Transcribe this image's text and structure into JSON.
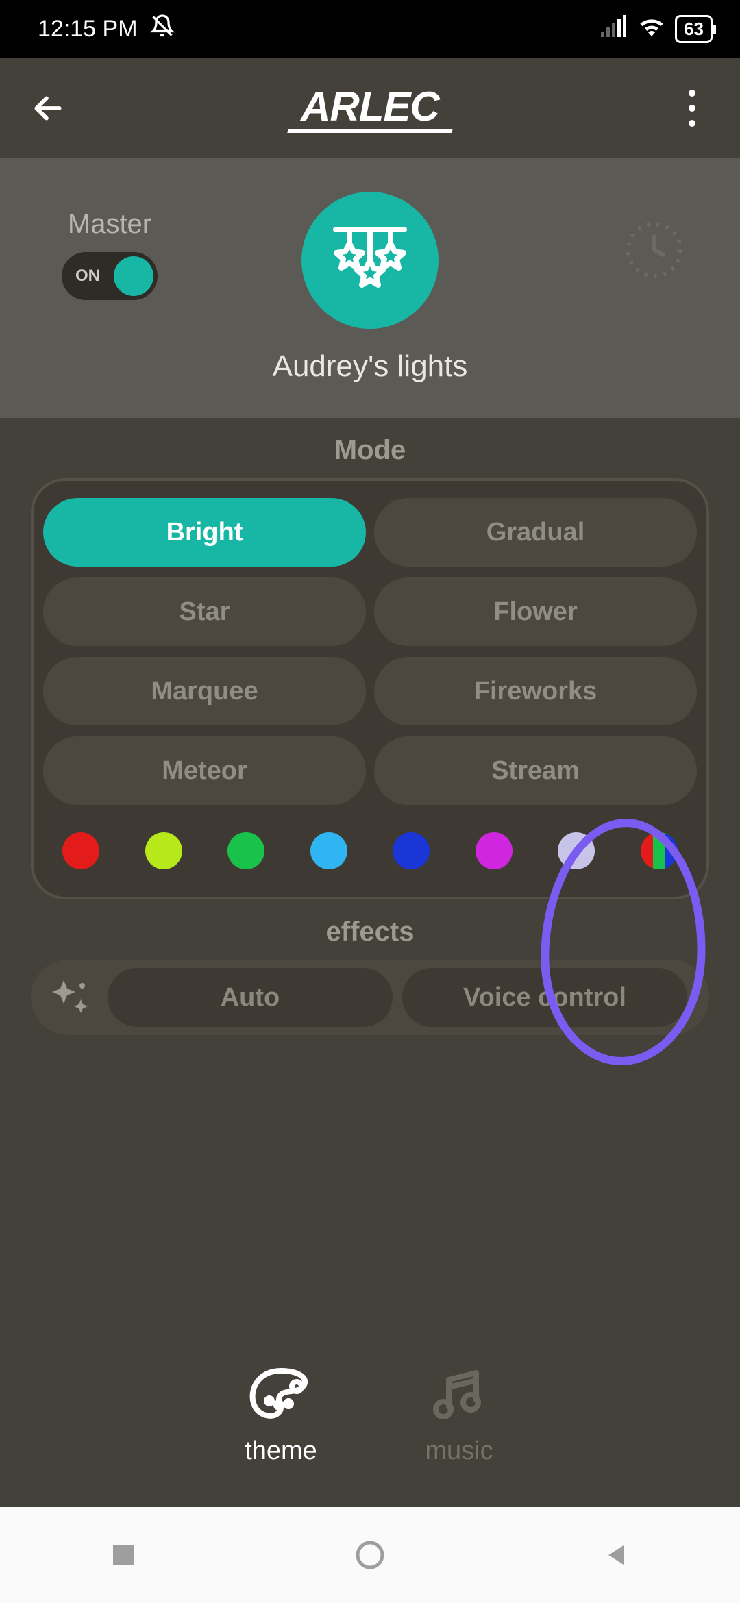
{
  "status": {
    "time": "12:15 PM",
    "battery": "63"
  },
  "header": {
    "brand": "ARLEC"
  },
  "device": {
    "master_label": "Master",
    "toggle_state": "ON",
    "name": "Audrey's lights"
  },
  "mode": {
    "title": "Mode",
    "buttons": [
      "Bright",
      "Gradual",
      "Star",
      "Flower",
      "Marquee",
      "Fireworks",
      "Meteor",
      "Stream"
    ],
    "active_index": 0,
    "colors": [
      "#e31b1b",
      "#b6e81a",
      "#19c24a",
      "#2fb6f2",
      "#1a36d6",
      "#d026e0",
      "#c7c4e8",
      "rgb"
    ]
  },
  "effects": {
    "title": "effects",
    "buttons": [
      "Auto",
      "Voice control"
    ]
  },
  "tabs": {
    "items": [
      {
        "label": "theme",
        "active": true
      },
      {
        "label": "music",
        "active": false
      }
    ]
  }
}
